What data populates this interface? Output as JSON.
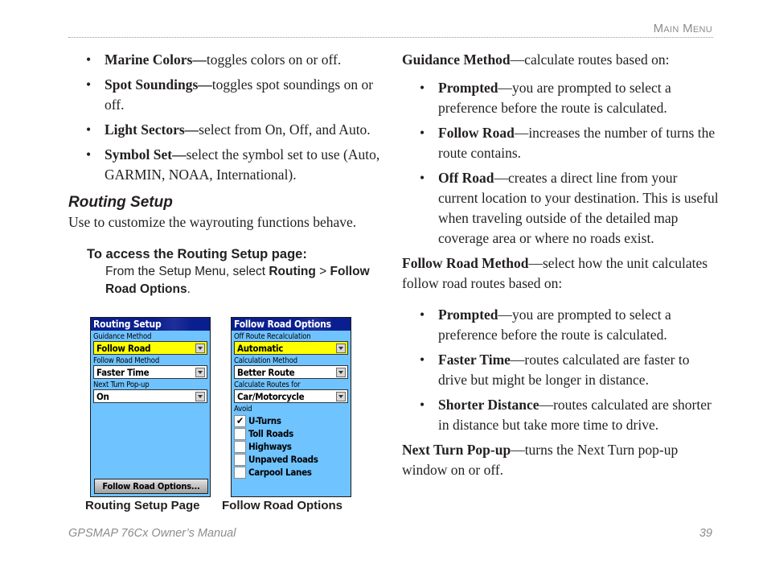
{
  "header": {
    "running_head": "Main Menu"
  },
  "left": {
    "bullets": [
      {
        "term": "Marine Colors—",
        "desc": "toggles colors on or off."
      },
      {
        "term": "Spot Soundings—",
        "desc": "toggles spot soundings on or off."
      },
      {
        "term": "Light Sectors—",
        "desc": "select from On, Off, and Auto."
      },
      {
        "term": "Symbol Set—",
        "desc": "select the symbol set to use (Auto, GARMIN, NOAA, International)."
      }
    ],
    "section_title": "Routing Setup",
    "intro": "Use to customize the wayrouting functions behave.",
    "procedure_title": "To access the Routing Setup page:",
    "procedure": {
      "prefix": "From the Setup Menu, select ",
      "item1": "Routing",
      "sep": " > ",
      "item2": "Follow Road Options",
      "suffix": "."
    }
  },
  "screens": {
    "routing_setup": {
      "title": "Routing Setup",
      "fields": [
        {
          "label": "Guidance Method",
          "value": "Follow Road",
          "highlighted": true
        },
        {
          "label": "Follow Road Method",
          "value": "Faster Time",
          "highlighted": false
        },
        {
          "label": "Next Turn Pop-up",
          "value": "On",
          "highlighted": false
        }
      ],
      "button": "Follow Road Options...",
      "caption": "Routing Setup Page"
    },
    "follow_road_options": {
      "title": "Follow Road Options",
      "fields": [
        {
          "label": "Off Route Recalculation",
          "value": "Automatic",
          "highlighted": true
        },
        {
          "label": "Calculation Method",
          "value": "Better Route",
          "highlighted": false
        },
        {
          "label": "Calculate Routes for",
          "value": "Car/Motorcycle",
          "highlighted": false
        }
      ],
      "avoid_label": "Avoid",
      "avoid_items": [
        {
          "label": "U-Turns",
          "checked": true,
          "mark": "✔"
        },
        {
          "label": "Toll Roads",
          "checked": false,
          "mark": ""
        },
        {
          "label": "Highways",
          "checked": false,
          "mark": ""
        },
        {
          "label": "Unpaved Roads",
          "checked": false,
          "mark": ""
        },
        {
          "label": "Carpool Lanes",
          "checked": false,
          "mark": ""
        }
      ],
      "caption": "Follow Road Options"
    },
    "colors": {
      "screen_bg": "#6fc3ff",
      "title_bg": "#0a1f8f",
      "highlight": "#ffff00"
    }
  },
  "right": {
    "guidance": {
      "term": "Guidance Method",
      "desc": "—calculate routes based on:"
    },
    "guidance_bullets": [
      {
        "term": "Prompted",
        "desc": "—you are prompted to select a preference before the route is calculated."
      },
      {
        "term": "Follow Road",
        "desc": "—increases the number of turns the route contains."
      },
      {
        "term": "Off Road",
        "desc": "—creates a direct line from your current location to your destination. This is useful when traveling outside of the detailed map coverage area or where no roads exist."
      }
    ],
    "follow_road_method": {
      "term": "Follow Road Method",
      "desc": "—select how the unit calculates follow road routes based on:"
    },
    "method_bullets": [
      {
        "term": "Prompted",
        "desc": "—you are prompted to select a preference before the route is calculated."
      },
      {
        "term": "Faster Time",
        "desc": "—routes calculated are faster to drive but might be longer in distance."
      },
      {
        "term": "Shorter Distance",
        "desc": "—routes calculated are shorter in distance but take more time to drive."
      }
    ],
    "next_turn": {
      "term": "Next Turn Pop-up",
      "desc": "—turns the Next Turn pop-up window on or off."
    }
  },
  "footer": {
    "manual_title": "GPSMAP 76Cx Owner’s Manual",
    "page_number": "39"
  }
}
